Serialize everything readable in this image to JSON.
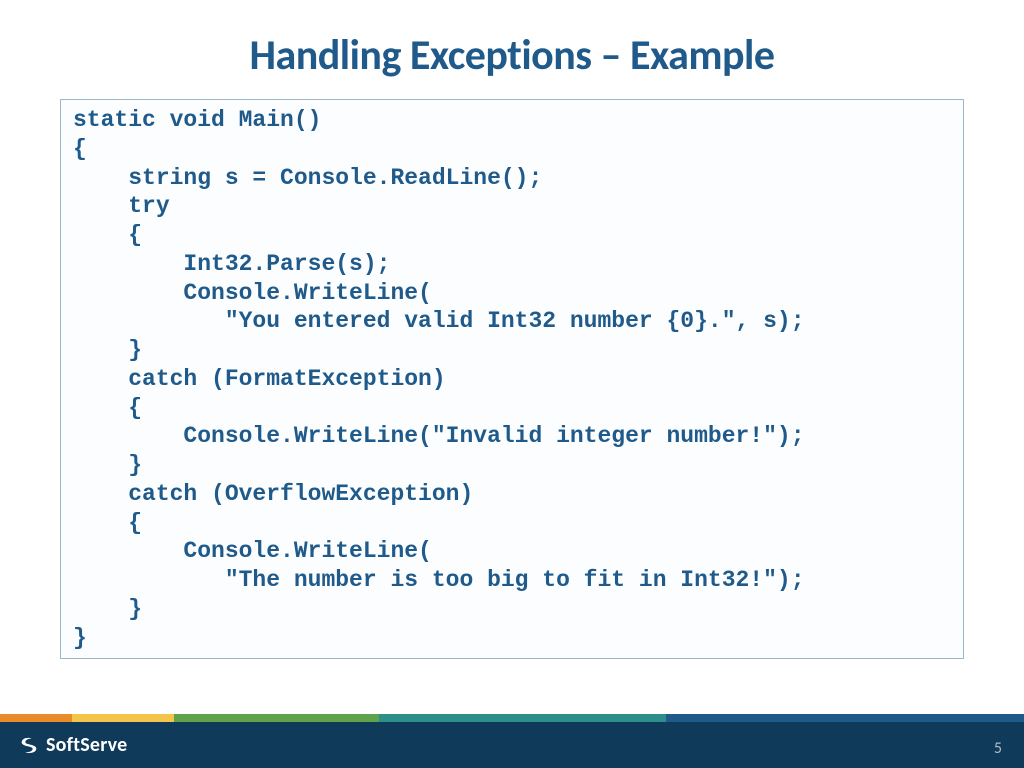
{
  "title": "Handling Exceptions – Example",
  "code_lines": [
    "static void Main()",
    "{",
    "    string s = Console.ReadLine();",
    "    try",
    "    {",
    "        Int32.Parse(s);",
    "        Console.WriteLine(",
    "           \"You entered valid Int32 number {0}.\", s);",
    "    }",
    "    catch (FormatException)",
    "    {",
    "        Console.WriteLine(\"Invalid integer number!\");",
    "    }",
    "    catch (OverflowException)",
    "    {",
    "        Console.WriteLine(",
    "           \"The number is too big to fit in Int32!\");",
    "    }",
    "}"
  ],
  "footer": {
    "brand": "SoftServe",
    "page_number": "5"
  }
}
